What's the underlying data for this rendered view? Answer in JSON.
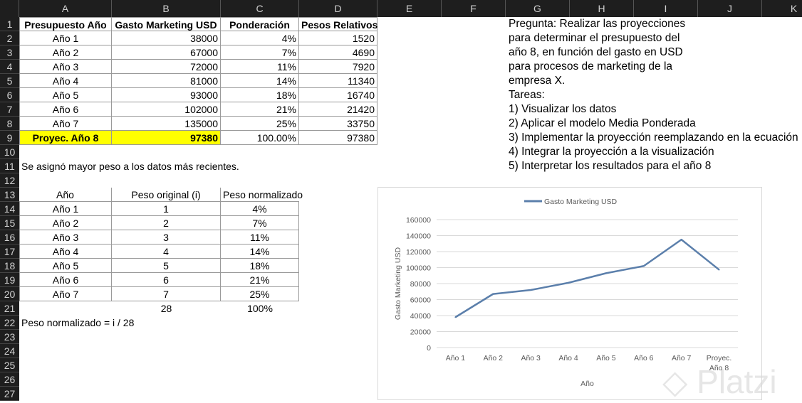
{
  "sheet": {
    "columns": [
      "A",
      "B",
      "C",
      "D",
      "E",
      "F",
      "G",
      "H",
      "I",
      "J",
      "K"
    ],
    "row_numbers": [
      "1",
      "2",
      "3",
      "4",
      "5",
      "6",
      "7",
      "8",
      "9",
      "10",
      "11",
      "12",
      "13",
      "14",
      "15",
      "16",
      "17",
      "18",
      "19",
      "20",
      "21",
      "22",
      "23",
      "24",
      "25",
      "26",
      "27"
    ]
  },
  "table1": {
    "headers": [
      "Presupuesto Año",
      "Gasto Marketing USD",
      "Ponderación",
      "Pesos Relativos"
    ],
    "rows": [
      [
        "Año 1",
        "38000",
        "4%",
        "1520"
      ],
      [
        "Año 2",
        "67000",
        "7%",
        "4690"
      ],
      [
        "Año 3",
        "72000",
        "11%",
        "7920"
      ],
      [
        "Año 4",
        "81000",
        "14%",
        "11340"
      ],
      [
        "Año 5",
        "93000",
        "18%",
        "16740"
      ],
      [
        "Año 6",
        "102000",
        "21%",
        "21420"
      ],
      [
        "Año 7",
        "135000",
        "25%",
        "33750"
      ],
      [
        "Proyec. Año 8",
        "97380",
        "100.00%",
        "97380"
      ]
    ],
    "highlight_color": "#ffff00"
  },
  "note1": "Se asignó mayor peso a los datos más recientes.",
  "table2": {
    "headers": [
      "Año",
      "Peso original (i)",
      "Peso normalizado"
    ],
    "rows": [
      [
        "Año 1",
        "1",
        "4%"
      ],
      [
        "Año 2",
        "2",
        "7%"
      ],
      [
        "Año 3",
        "3",
        "11%"
      ],
      [
        "Año 4",
        "4",
        "14%"
      ],
      [
        "Año 5",
        "5",
        "18%"
      ],
      [
        "Año 6",
        "6",
        "21%"
      ],
      [
        "Año 7",
        "7",
        "25%"
      ]
    ],
    "totals": [
      "28",
      "100%"
    ]
  },
  "note2": "Peso normalizado = i / 28",
  "question": [
    "Pregunta: Realizar las proyecciones",
    "para determinar el presupuesto del",
    "año 8, en función del gasto en USD",
    "para procesos de marketing de la",
    "empresa X.",
    "Tareas:",
    "1) Visualizar los datos",
    "2) Aplicar el modelo Media Ponderada",
    "3) Implementar la proyección reemplazando en la ecuación",
    "4) Integrar la proyección a la visualización",
    "5) Interpretar los resultados para el año 8"
  ],
  "watermark": "Platzi",
  "chart_data": {
    "type": "line",
    "title": "",
    "legend": [
      "Gasto Marketing USD"
    ],
    "legend_position": "top",
    "categories": [
      "Año 1",
      "Año 2",
      "Año 3",
      "Año 4",
      "Año 5",
      "Año 6",
      "Año 7",
      "Proyec. Año 8"
    ],
    "series": [
      {
        "name": "Gasto Marketing USD",
        "values": [
          38000,
          67000,
          72000,
          81000,
          93000,
          102000,
          135000,
          97380
        ]
      }
    ],
    "xlabel": "Año",
    "ylabel": "Gasto Marketing USD",
    "ylim": [
      0,
      160000
    ],
    "yticks": [
      "0",
      "20000",
      "40000",
      "60000",
      "80000",
      "100000",
      "120000",
      "140000",
      "160000"
    ],
    "grid": true,
    "color": "#5b7fab"
  }
}
